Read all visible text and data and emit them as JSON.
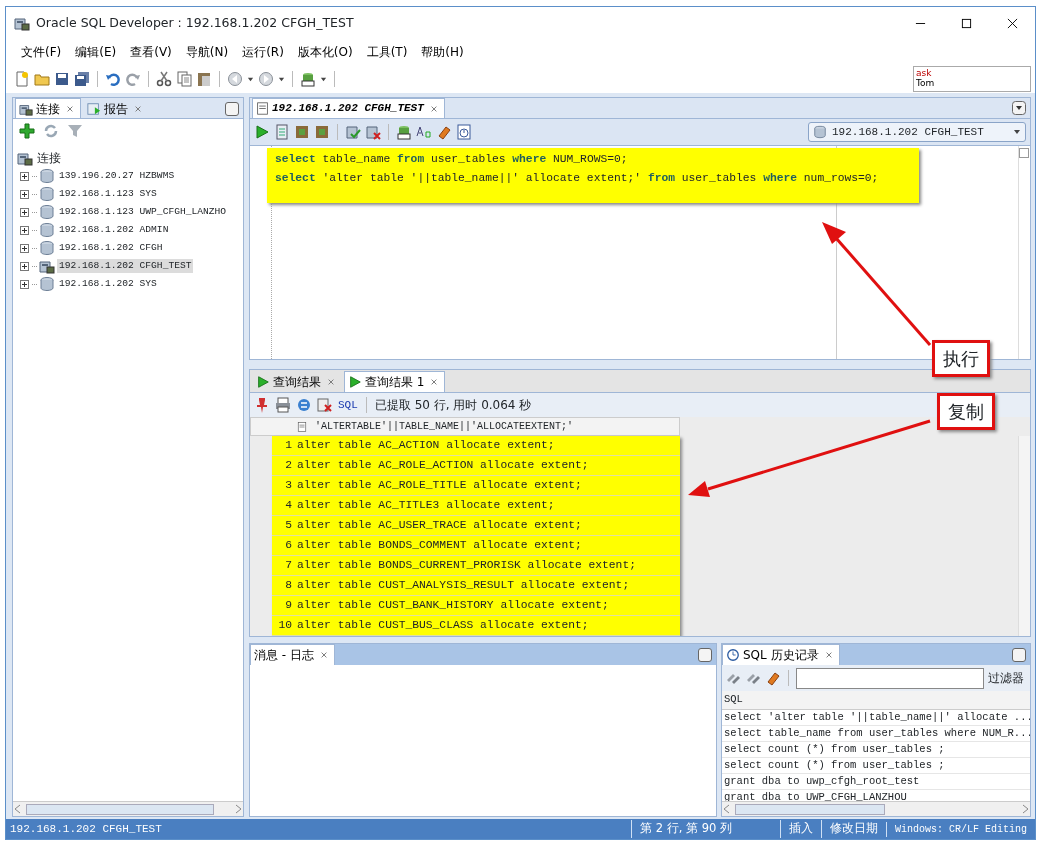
{
  "window": {
    "title": "Oracle SQL Developer : 192.168.1.202 CFGH_TEST"
  },
  "menu": [
    "文件(F)",
    "编辑(E)",
    "查看(V)",
    "导航(N)",
    "运行(R)",
    "版本化(O)",
    "工具(T)",
    "帮助(H)"
  ],
  "ask_widget": {
    "line_1": "ask",
    "line_2": "Tom"
  },
  "left_panel": {
    "tabs": [
      {
        "label": "连接",
        "selected": true
      },
      {
        "label": "报告",
        "selected": false
      }
    ],
    "tree": {
      "label": "连接",
      "children": [
        {
          "label": "139.196.20.27 HZBWMS",
          "selected": false,
          "connected": false
        },
        {
          "label": "192.168.1.123 SYS",
          "selected": false,
          "connected": false
        },
        {
          "label": "192.168.1.123 UWP_CFGH_LANZHO",
          "selected": false,
          "connected": false
        },
        {
          "label": "192.168.1.202 ADMIN",
          "selected": false,
          "connected": false
        },
        {
          "label": "192.168.1.202 CFGH",
          "selected": false,
          "connected": false
        },
        {
          "label": "192.168.1.202 CFGH_TEST",
          "selected": true,
          "connected": true
        },
        {
          "label": "192.168.1.202 SYS",
          "selected": false,
          "connected": false
        }
      ]
    }
  },
  "editor": {
    "tab": "192.168.1.202 CFGH_TEST",
    "connection": "192.168.1.202 CFGH_TEST",
    "lines": [
      "**select** table_name **from** user_tables **where** NUM_ROWS=0;",
      "**select** 'alter table '||table_name||' allocate extent;' **from** user_tables **where** num_rows=0;"
    ]
  },
  "results": {
    "tabs": [
      {
        "label": "查询结果",
        "selected": false
      },
      {
        "label": "查询结果 1",
        "selected": true
      }
    ],
    "sql_button": "SQL",
    "status": "已提取 50 行, 用时 0.064 秒",
    "column": "'ALTERTABLE'||TABLE_NAME||'ALLOCATEEXTENT;'",
    "rows": [
      {
        "num": "1",
        "value": "alter table AC_ACTION allocate extent;"
      },
      {
        "num": "2",
        "value": "alter table AC_ROLE_ACTION allocate extent;"
      },
      {
        "num": "3",
        "value": "alter table AC_ROLE_TITLE allocate extent;"
      },
      {
        "num": "4",
        "value": "alter table AC_TITLE3 allocate extent;"
      },
      {
        "num": "5",
        "value": "alter table AC_USER_TRACE allocate extent;"
      },
      {
        "num": "6",
        "value": "alter table BONDS_COMMENT allocate extent;"
      },
      {
        "num": "7",
        "value": "alter table BONDS_CURRENT_PRORISK allocate extent;"
      },
      {
        "num": "8",
        "value": "alter table CUST_ANALYSIS_RESULT allocate extent;"
      },
      {
        "num": "9",
        "value": "alter table CUST_BANK_HISTORY allocate extent;"
      },
      {
        "num": "10",
        "value": "alter table CUST_BUS_CLASS allocate extent;"
      }
    ]
  },
  "messages": {
    "title": "消息 - 日志"
  },
  "history": {
    "title": "SQL 历史记录",
    "filter_label": "过滤器",
    "column": "SQL",
    "rows": [
      "select 'alter table '||table_name||' allocate ...",
      "select table_name from user_tables where NUM_R...",
      "select count (*)  from user_tables ;",
      "select count (*)  from user_tables ;",
      "grant dba to uwp_cfgh_root_test",
      "grant dba to UWP_CFGH_LANZHOU"
    ]
  },
  "status_bar": {
    "connection": "192.168.1.202 CFGH_TEST",
    "cells": [
      "第 2 行, 第 90 列",
      "插入",
      "修改日期",
      "Windows: CR/LF Editing"
    ]
  },
  "annotations": [
    {
      "text": "执行"
    },
    {
      "text": "复制"
    }
  ]
}
